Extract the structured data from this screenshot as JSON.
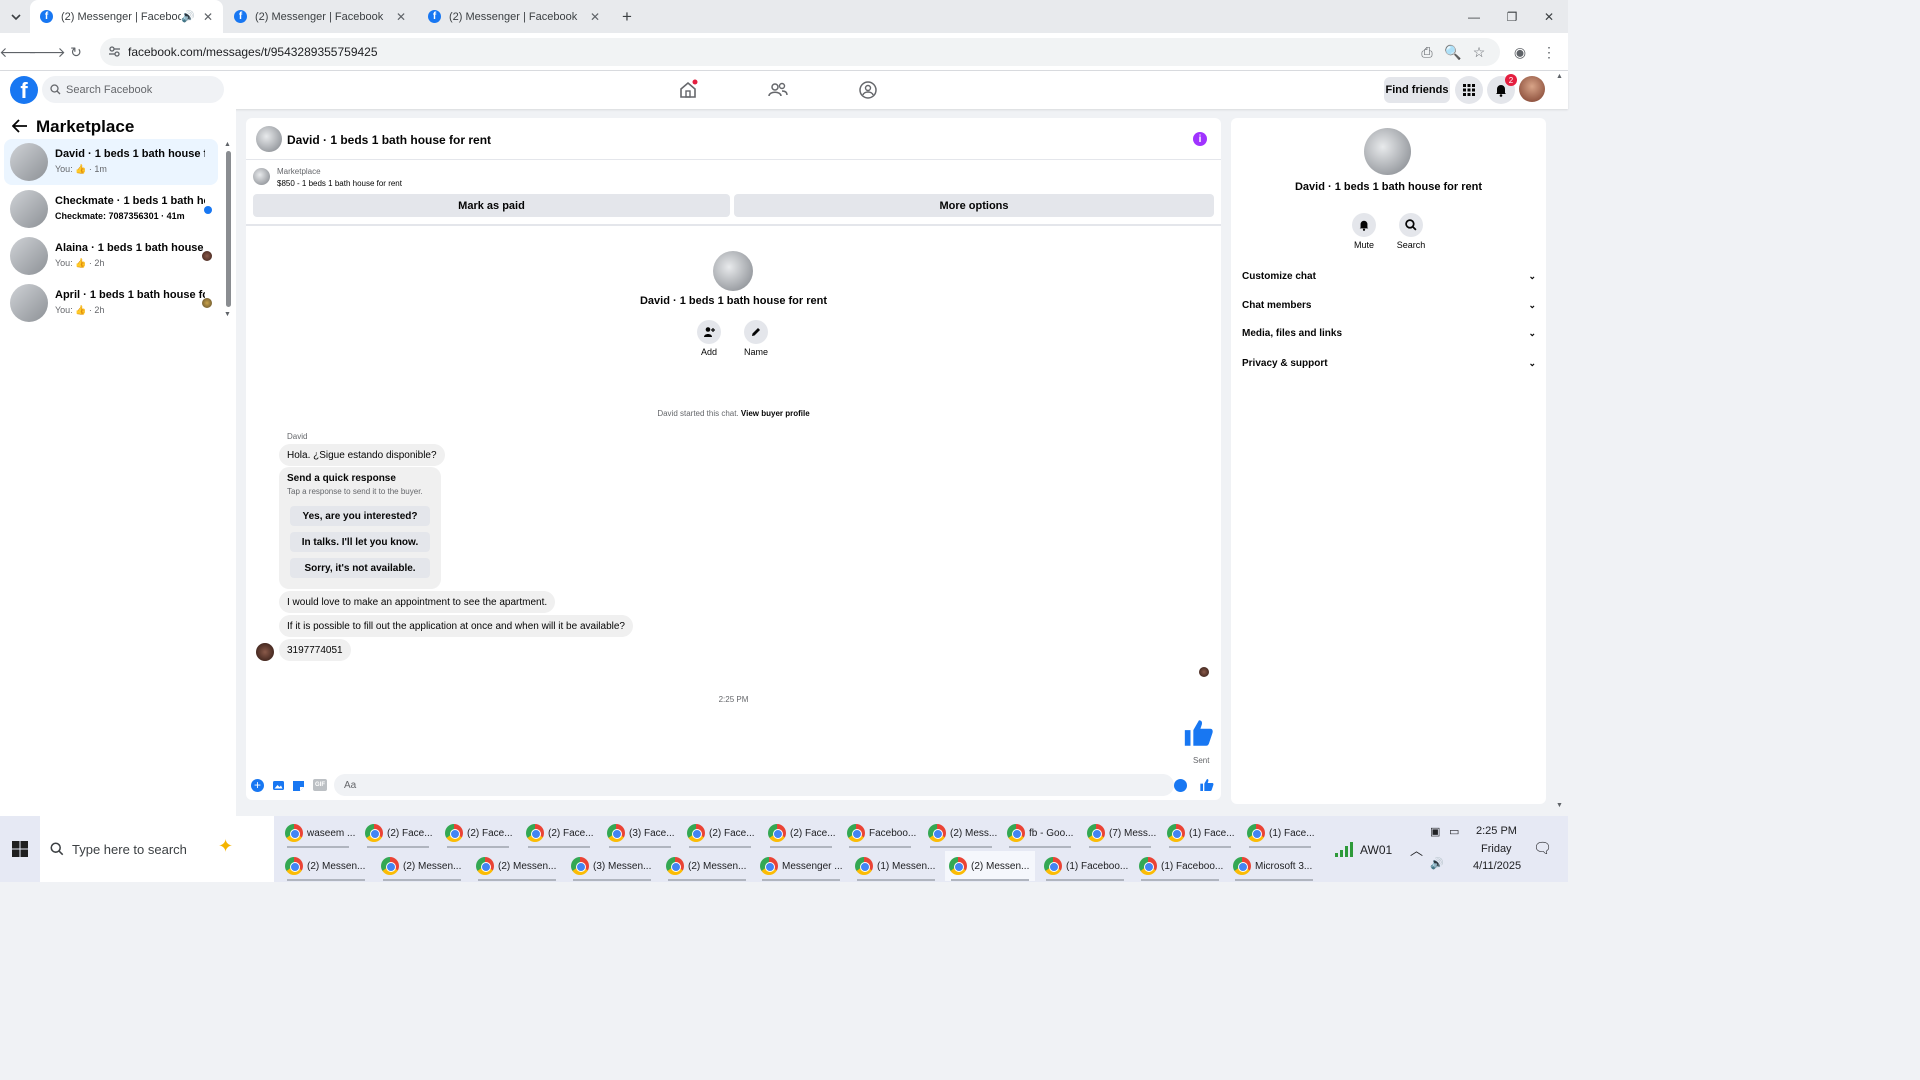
{
  "browser": {
    "tabs": [
      {
        "title": "(2) Messenger | Facebook",
        "active": true
      },
      {
        "title": "(2) Messenger | Facebook",
        "active": false
      },
      {
        "title": "(2) Messenger | Facebook",
        "active": false
      }
    ],
    "url": "facebook.com/messages/t/9543289355759425"
  },
  "fb": {
    "search_placeholder": "Search Facebook",
    "find_friends": "Find friends",
    "notifications_count": "2"
  },
  "left": {
    "title": "Marketplace",
    "conversations": [
      {
        "title": "David · 1 beds 1 bath house for ...",
        "sub": "You: 👍 · 1m",
        "selected": true,
        "unread": false
      },
      {
        "title": "Checkmate · 1 beds 1 bath ho...",
        "sub": "Checkmate: 7087356301 · 41m",
        "selected": false,
        "unread": true
      },
      {
        "title": "Alaina · 1 beds 1 bath house f...",
        "sub": "You: 👍 · 2h",
        "selected": false,
        "unread": false
      },
      {
        "title": "April · 1 beds 1 bath house for...",
        "sub": "You: 👍 · 2h",
        "selected": false,
        "unread": false
      }
    ]
  },
  "chat": {
    "title": "David · 1 beds 1 bath house for rent",
    "marketplace_label": "Marketplace",
    "listing": "$850 - 1 beds 1 bath house for rent",
    "mark_paid": "Mark as paid",
    "more_options": "More options",
    "profile_name": "David · 1 beds 1 bath house for rent",
    "add_label": "Add",
    "name_label": "Name",
    "started_text": "David started this chat.",
    "view_profile": "View buyer profile",
    "sender": "David",
    "messages": [
      "Hola. ¿Sigue estando disponible?",
      "I would love to make an appointment to see the apartment.",
      "If it is possible to fill out the application at once and when will it be available?",
      "3197774051"
    ],
    "quick_response": {
      "title": "Send a quick response",
      "subtitle": "Tap a response to send it to the buyer.",
      "options": [
        "Yes, are you interested?",
        "In talks. I'll let you know.",
        "Sorry, it's not available."
      ]
    },
    "time": "2:25 PM",
    "sent_label": "Sent",
    "composer_placeholder": "Aa"
  },
  "right": {
    "name": "David · 1 beds 1 bath house for rent",
    "mute": "Mute",
    "search": "Search",
    "sections": [
      "Customize chat",
      "Chat members",
      "Media, files and links",
      "Privacy & support"
    ]
  },
  "taskbar": {
    "search_placeholder": "Type here to search",
    "row1": [
      "waseem ...",
      "(2) Face...",
      "(2) Face...",
      "(2) Face...",
      "(3) Face...",
      "(2) Face...",
      "(2) Face...",
      "Faceboo...",
      "(2) Mess...",
      "fb - Goo...",
      "(7) Mess...",
      "(1) Face...",
      "(1) Face..."
    ],
    "row2": [
      "(2) Messen...",
      "(2) Messen...",
      "(2) Messen...",
      "(3) Messen...",
      "(2) Messen...",
      "Messenger ...",
      "(1) Messen...",
      "(2) Messen...",
      "(1) Faceboo...",
      "(1) Faceboo...",
      "Microsoft 3..."
    ],
    "network_label": "AW01",
    "clock_time": "2:25 PM",
    "clock_day": "Friday",
    "clock_date": "4/11/2025"
  },
  "colors": {
    "fb_blue": "#1877f2",
    "bg": "#f0f2f5",
    "unread_dot": "#1877f2",
    "info_purple": "#a033ff"
  }
}
